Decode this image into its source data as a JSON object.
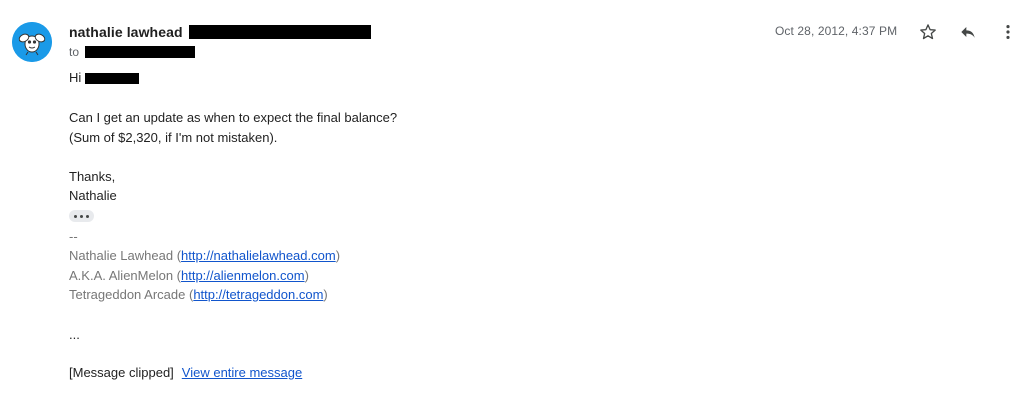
{
  "sender": {
    "name": "nathalie lawhead",
    "to_label": "to"
  },
  "date": "Oct 28, 2012, 4:37 PM",
  "actions": {
    "star_icon": "star-icon",
    "reply_icon": "reply-icon",
    "more_icon": "more-vert-icon"
  },
  "message": {
    "greeting": "Hi",
    "line1": "Can I get an update as when to expect the final balance?",
    "line2": "(Sum of $2,320, if I'm not mistaken).",
    "closing": "Thanks,",
    "signoff_name": "Nathalie",
    "sig_dash": "--",
    "signature": [
      {
        "prefix": "Nathalie Lawhead (",
        "link": "http://nathalielawhead.com",
        "suffix": ")"
      },
      {
        "prefix": "A.K.A. AlienMelon (",
        "link": "http://alienmelon.com",
        "suffix": ")"
      },
      {
        "prefix": "Tetrageddon Arcade (",
        "link": "http://tetrageddon.com",
        "suffix": ")"
      }
    ],
    "trailing_dots": "...",
    "clipped_notice": "[Message clipped]",
    "view_entire": "View entire message"
  },
  "colors": {
    "avatar_bg": "#1a9ae8",
    "link": "#1155cc",
    "signature_text": "#777777"
  }
}
